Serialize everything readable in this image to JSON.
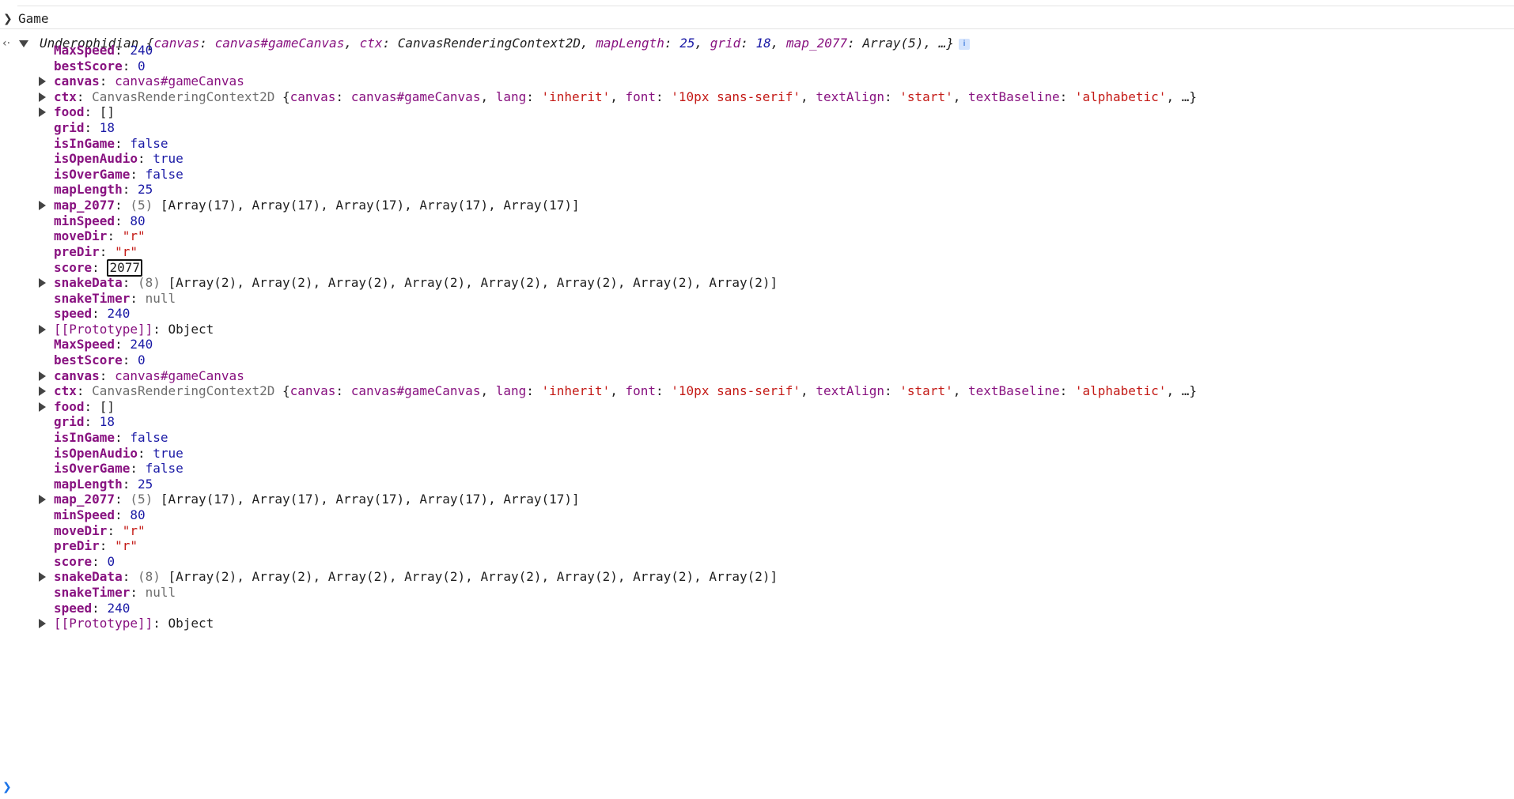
{
  "console": {
    "command": "Game",
    "result": {
      "class_name": "Underophidian",
      "summary_open": "{",
      "summary_items": [
        {
          "key": "canvas",
          "value": "canvas#gameCanvas",
          "kind": "elem"
        },
        {
          "key": "ctx",
          "value": "CanvasRenderingContext2D",
          "kind": "plain"
        },
        {
          "key": "mapLength",
          "value": "25",
          "kind": "num"
        },
        {
          "key": "grid",
          "value": "18",
          "kind": "num"
        },
        {
          "key": "map_2077",
          "value": "Array(5)",
          "kind": "plain"
        }
      ],
      "summary_close": ", …}",
      "info_label": "i"
    },
    "groups": [
      {
        "props": [
          {
            "key": "MaxSpeed",
            "value": "240",
            "kind": "num",
            "expandable": false
          },
          {
            "key": "bestScore",
            "value": "0",
            "kind": "num",
            "expandable": false
          },
          {
            "key": "canvas",
            "value": "canvas#gameCanvas",
            "kind": "elem",
            "expandable": true
          },
          {
            "key": "ctx",
            "value": "CanvasRenderingContext2D",
            "kind": "ctx",
            "expandable": true
          },
          {
            "key": "food",
            "value": "[]",
            "kind": "plain",
            "expandable": true
          },
          {
            "key": "grid",
            "value": "18",
            "kind": "num",
            "expandable": false
          },
          {
            "key": "isInGame",
            "value": "false",
            "kind": "bool",
            "expandable": false
          },
          {
            "key": "isOpenAudio",
            "value": "true",
            "kind": "bool",
            "expandable": false
          },
          {
            "key": "isOverGame",
            "value": "false",
            "kind": "bool",
            "expandable": false
          },
          {
            "key": "mapLength",
            "value": "25",
            "kind": "num",
            "expandable": false
          },
          {
            "key": "map_2077",
            "value": "[Array(17), Array(17), Array(17), Array(17), Array(17)]",
            "count": "(5)",
            "kind": "array",
            "expandable": true
          },
          {
            "key": "minSpeed",
            "value": "80",
            "kind": "num",
            "expandable": false
          },
          {
            "key": "moveDir",
            "value": "\"r\"",
            "kind": "str",
            "expandable": false
          },
          {
            "key": "preDir",
            "value": "\"r\"",
            "kind": "str",
            "expandable": false
          },
          {
            "key": "score",
            "value": "2077",
            "kind": "edit",
            "expandable": false
          },
          {
            "key": "snakeData",
            "value": "[Array(2), Array(2), Array(2), Array(2), Array(2), Array(2), Array(2), Array(2)]",
            "count": "(8)",
            "kind": "array",
            "expandable": true
          },
          {
            "key": "snakeTimer",
            "value": "null",
            "kind": "null",
            "expandable": false
          },
          {
            "key": "speed",
            "value": "240",
            "kind": "num",
            "expandable": false
          },
          {
            "key": "[[Prototype]]",
            "value": "Object",
            "kind": "proto",
            "expandable": true
          }
        ]
      },
      {
        "props": [
          {
            "key": "MaxSpeed",
            "value": "240",
            "kind": "num",
            "expandable": false
          },
          {
            "key": "bestScore",
            "value": "0",
            "kind": "num",
            "expandable": false
          },
          {
            "key": "canvas",
            "value": "canvas#gameCanvas",
            "kind": "elem",
            "expandable": true
          },
          {
            "key": "ctx",
            "value": "CanvasRenderingContext2D",
            "kind": "ctx",
            "expandable": true
          },
          {
            "key": "food",
            "value": "[]",
            "kind": "plain",
            "expandable": true
          },
          {
            "key": "grid",
            "value": "18",
            "kind": "num",
            "expandable": false
          },
          {
            "key": "isInGame",
            "value": "false",
            "kind": "bool",
            "expandable": false
          },
          {
            "key": "isOpenAudio",
            "value": "true",
            "kind": "bool",
            "expandable": false
          },
          {
            "key": "isOverGame",
            "value": "false",
            "kind": "bool",
            "expandable": false
          },
          {
            "key": "mapLength",
            "value": "25",
            "kind": "num",
            "expandable": false
          },
          {
            "key": "map_2077",
            "value": "[Array(17), Array(17), Array(17), Array(17), Array(17)]",
            "count": "(5)",
            "kind": "array",
            "expandable": true
          },
          {
            "key": "minSpeed",
            "value": "80",
            "kind": "num",
            "expandable": false
          },
          {
            "key": "moveDir",
            "value": "\"r\"",
            "kind": "str",
            "expandable": false
          },
          {
            "key": "preDir",
            "value": "\"r\"",
            "kind": "str",
            "expandable": false
          },
          {
            "key": "score",
            "value": "0",
            "kind": "num",
            "expandable": false
          },
          {
            "key": "snakeData",
            "value": "[Array(2), Array(2), Array(2), Array(2), Array(2), Array(2), Array(2), Array(2)]",
            "count": "(8)",
            "kind": "array",
            "expandable": true
          },
          {
            "key": "snakeTimer",
            "value": "null",
            "kind": "null",
            "expandable": false
          },
          {
            "key": "speed",
            "value": "240",
            "kind": "num",
            "expandable": false
          },
          {
            "key": "[[Prototype]]",
            "value": "Object",
            "kind": "proto",
            "expandable": true
          }
        ]
      }
    ],
    "ctx_preview": {
      "items": [
        {
          "key": "canvas",
          "value": "canvas#gameCanvas",
          "kind": "elem"
        },
        {
          "key": "lang",
          "value": "'inherit'",
          "kind": "str"
        },
        {
          "key": "font",
          "value": "'10px sans-serif'",
          "kind": "str"
        },
        {
          "key": "textAlign",
          "value": "'start'",
          "kind": "str"
        },
        {
          "key": "textBaseline",
          "value": "'alphabetic'",
          "kind": "str"
        }
      ],
      "tail": ", …}"
    }
  }
}
